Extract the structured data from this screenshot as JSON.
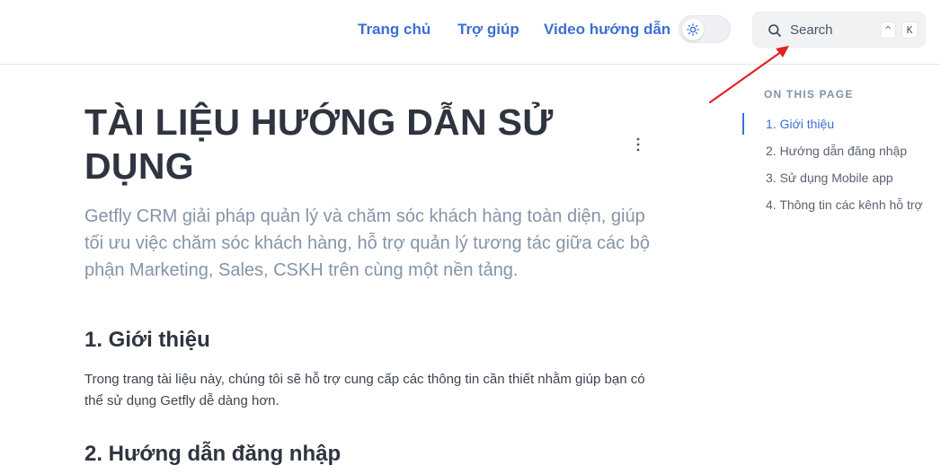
{
  "nav": {
    "links": [
      {
        "label": "Trang chủ"
      },
      {
        "label": "Trợ giúp"
      },
      {
        "label": "Video hướng dẫn"
      }
    ],
    "theme_icon": "sun-icon"
  },
  "search": {
    "placeholder": "Search",
    "shortcut": [
      "^",
      "K"
    ],
    "icon": "search-icon"
  },
  "annotation": {
    "color": "#e02424"
  },
  "main": {
    "title": "TÀI LIỆU HƯỚNG DẪN SỬ DỤNG",
    "lead": "Getfly CRM giải pháp quản lý và chăm sóc khách hàng toàn diện, giúp tối ưu việc chăm sóc khách hàng, hỗ trợ quản lý tương tác giữa các bộ phận Marketing, Sales, CSKH trên cùng một nền tảng.",
    "sections": [
      {
        "heading": "1. Giới thiệu",
        "text": "Trong trang tài liệu này, chúng tôi sẽ hỗ trợ cung cấp các thông tin cần thiết nhằm giúp bạn có thể sử dụng Getfly dễ dàng hơn."
      },
      {
        "heading": "2. Hướng dẫn đăng nhập"
      }
    ]
  },
  "toc": {
    "title": "ON THIS PAGE",
    "items": [
      {
        "label": "1. Giới thiệu",
        "active": true
      },
      {
        "label": "2. Hướng dẫn đăng nhập"
      },
      {
        "label": "3. Sử dụng Mobile app"
      },
      {
        "label": "4. Thông tin các kênh hỗ trợ"
      }
    ]
  },
  "colors": {
    "accent": "#3b6fd4",
    "muted_text": "#8594a8",
    "arrow": "#e02424"
  }
}
